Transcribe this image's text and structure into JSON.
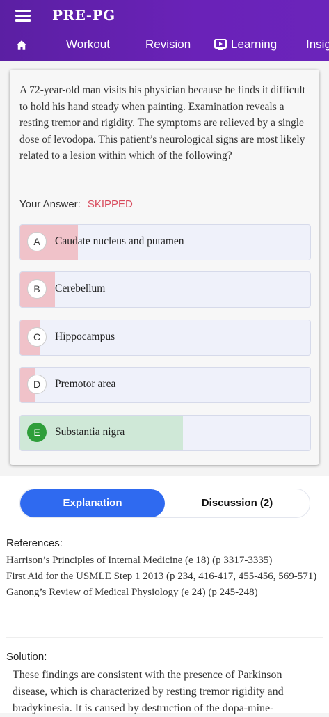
{
  "header": {
    "title": "PRE-PG"
  },
  "nav": {
    "tabs": [
      {
        "label": "Workout"
      },
      {
        "label": "Revision"
      },
      {
        "label": "Learning"
      },
      {
        "label": "Insig"
      }
    ]
  },
  "question": {
    "text": "A 72-year-old man visits his physician because he finds it difficult to hold his hand steady when painting. Examination reveals a resting tremor and rigidity. The symptoms are relieved by a single dose of levodopa. This patient’s neurological signs are most likely related to a lesion within which of the following?"
  },
  "answer": {
    "label": "Your Answer:",
    "value": "SKIPPED"
  },
  "options": [
    {
      "letter": "A",
      "text": "Caudate nucleus and putamen",
      "percent": 20,
      "correct": false
    },
    {
      "letter": "B",
      "text": "Cerebellum",
      "percent": 12,
      "correct": false
    },
    {
      "letter": "C",
      "text": "Hippocampus",
      "percent": 7,
      "correct": false
    },
    {
      "letter": "D",
      "text": "Premotor area",
      "percent": 5,
      "correct": false
    },
    {
      "letter": "E",
      "text": "Substantia nigra",
      "percent": 56,
      "correct": true
    }
  ],
  "colors": {
    "wrong_fill": "#f0c2c9",
    "correct_fill": "#cfe8d7",
    "accent": "#2f6af0",
    "header": "#6a22b8"
  },
  "toggle": {
    "explanation": "Explanation",
    "discussion": "Discussion (2)"
  },
  "references": {
    "title": "References:",
    "items": [
      "Harrison’s Principles of Internal Medicine (e 18) (p 3317-3335)",
      "First Aid for the USMLE Step 1 2013 (p 234, 416-417, 455-456, 569-571)",
      "Ganong’s Review of Medical Physiology (e 24) (p 245-248)"
    ]
  },
  "solution": {
    "title": "Solution:",
    "text": "These findings are consistent with the presence of Parkinson disease, which is characterized by resting tremor rigidity and bradykinesia. It is caused by destruction of the dopa-mine-"
  }
}
